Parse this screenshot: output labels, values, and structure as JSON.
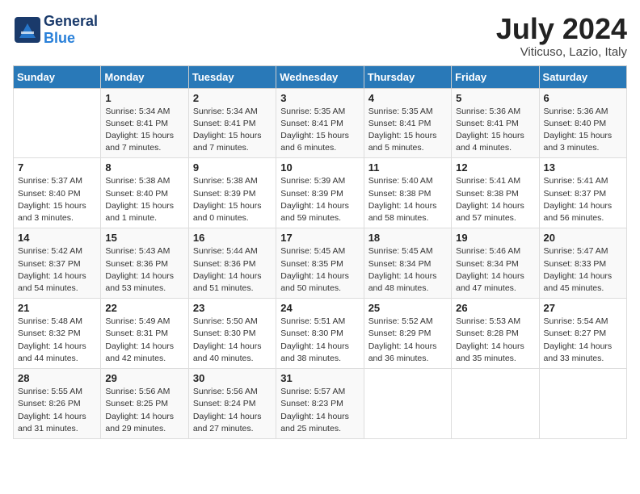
{
  "header": {
    "logo_general": "General",
    "logo_blue": "Blue",
    "month_title": "July 2024",
    "location": "Viticuso, Lazio, Italy"
  },
  "days_of_week": [
    "Sunday",
    "Monday",
    "Tuesday",
    "Wednesday",
    "Thursday",
    "Friday",
    "Saturday"
  ],
  "weeks": [
    [
      {
        "day": "",
        "info": ""
      },
      {
        "day": "1",
        "info": "Sunrise: 5:34 AM\nSunset: 8:41 PM\nDaylight: 15 hours\nand 7 minutes."
      },
      {
        "day": "2",
        "info": "Sunrise: 5:34 AM\nSunset: 8:41 PM\nDaylight: 15 hours\nand 7 minutes."
      },
      {
        "day": "3",
        "info": "Sunrise: 5:35 AM\nSunset: 8:41 PM\nDaylight: 15 hours\nand 6 minutes."
      },
      {
        "day": "4",
        "info": "Sunrise: 5:35 AM\nSunset: 8:41 PM\nDaylight: 15 hours\nand 5 minutes."
      },
      {
        "day": "5",
        "info": "Sunrise: 5:36 AM\nSunset: 8:41 PM\nDaylight: 15 hours\nand 4 minutes."
      },
      {
        "day": "6",
        "info": "Sunrise: 5:36 AM\nSunset: 8:40 PM\nDaylight: 15 hours\nand 3 minutes."
      }
    ],
    [
      {
        "day": "7",
        "info": "Sunrise: 5:37 AM\nSunset: 8:40 PM\nDaylight: 15 hours\nand 3 minutes."
      },
      {
        "day": "8",
        "info": "Sunrise: 5:38 AM\nSunset: 8:40 PM\nDaylight: 15 hours\nand 1 minute."
      },
      {
        "day": "9",
        "info": "Sunrise: 5:38 AM\nSunset: 8:39 PM\nDaylight: 15 hours\nand 0 minutes."
      },
      {
        "day": "10",
        "info": "Sunrise: 5:39 AM\nSunset: 8:39 PM\nDaylight: 14 hours\nand 59 minutes."
      },
      {
        "day": "11",
        "info": "Sunrise: 5:40 AM\nSunset: 8:38 PM\nDaylight: 14 hours\nand 58 minutes."
      },
      {
        "day": "12",
        "info": "Sunrise: 5:41 AM\nSunset: 8:38 PM\nDaylight: 14 hours\nand 57 minutes."
      },
      {
        "day": "13",
        "info": "Sunrise: 5:41 AM\nSunset: 8:37 PM\nDaylight: 14 hours\nand 56 minutes."
      }
    ],
    [
      {
        "day": "14",
        "info": "Sunrise: 5:42 AM\nSunset: 8:37 PM\nDaylight: 14 hours\nand 54 minutes."
      },
      {
        "day": "15",
        "info": "Sunrise: 5:43 AM\nSunset: 8:36 PM\nDaylight: 14 hours\nand 53 minutes."
      },
      {
        "day": "16",
        "info": "Sunrise: 5:44 AM\nSunset: 8:36 PM\nDaylight: 14 hours\nand 51 minutes."
      },
      {
        "day": "17",
        "info": "Sunrise: 5:45 AM\nSunset: 8:35 PM\nDaylight: 14 hours\nand 50 minutes."
      },
      {
        "day": "18",
        "info": "Sunrise: 5:45 AM\nSunset: 8:34 PM\nDaylight: 14 hours\nand 48 minutes."
      },
      {
        "day": "19",
        "info": "Sunrise: 5:46 AM\nSunset: 8:34 PM\nDaylight: 14 hours\nand 47 minutes."
      },
      {
        "day": "20",
        "info": "Sunrise: 5:47 AM\nSunset: 8:33 PM\nDaylight: 14 hours\nand 45 minutes."
      }
    ],
    [
      {
        "day": "21",
        "info": "Sunrise: 5:48 AM\nSunset: 8:32 PM\nDaylight: 14 hours\nand 44 minutes."
      },
      {
        "day": "22",
        "info": "Sunrise: 5:49 AM\nSunset: 8:31 PM\nDaylight: 14 hours\nand 42 minutes."
      },
      {
        "day": "23",
        "info": "Sunrise: 5:50 AM\nSunset: 8:30 PM\nDaylight: 14 hours\nand 40 minutes."
      },
      {
        "day": "24",
        "info": "Sunrise: 5:51 AM\nSunset: 8:30 PM\nDaylight: 14 hours\nand 38 minutes."
      },
      {
        "day": "25",
        "info": "Sunrise: 5:52 AM\nSunset: 8:29 PM\nDaylight: 14 hours\nand 36 minutes."
      },
      {
        "day": "26",
        "info": "Sunrise: 5:53 AM\nSunset: 8:28 PM\nDaylight: 14 hours\nand 35 minutes."
      },
      {
        "day": "27",
        "info": "Sunrise: 5:54 AM\nSunset: 8:27 PM\nDaylight: 14 hours\nand 33 minutes."
      }
    ],
    [
      {
        "day": "28",
        "info": "Sunrise: 5:55 AM\nSunset: 8:26 PM\nDaylight: 14 hours\nand 31 minutes."
      },
      {
        "day": "29",
        "info": "Sunrise: 5:56 AM\nSunset: 8:25 PM\nDaylight: 14 hours\nand 29 minutes."
      },
      {
        "day": "30",
        "info": "Sunrise: 5:56 AM\nSunset: 8:24 PM\nDaylight: 14 hours\nand 27 minutes."
      },
      {
        "day": "31",
        "info": "Sunrise: 5:57 AM\nSunset: 8:23 PM\nDaylight: 14 hours\nand 25 minutes."
      },
      {
        "day": "",
        "info": ""
      },
      {
        "day": "",
        "info": ""
      },
      {
        "day": "",
        "info": ""
      }
    ]
  ]
}
